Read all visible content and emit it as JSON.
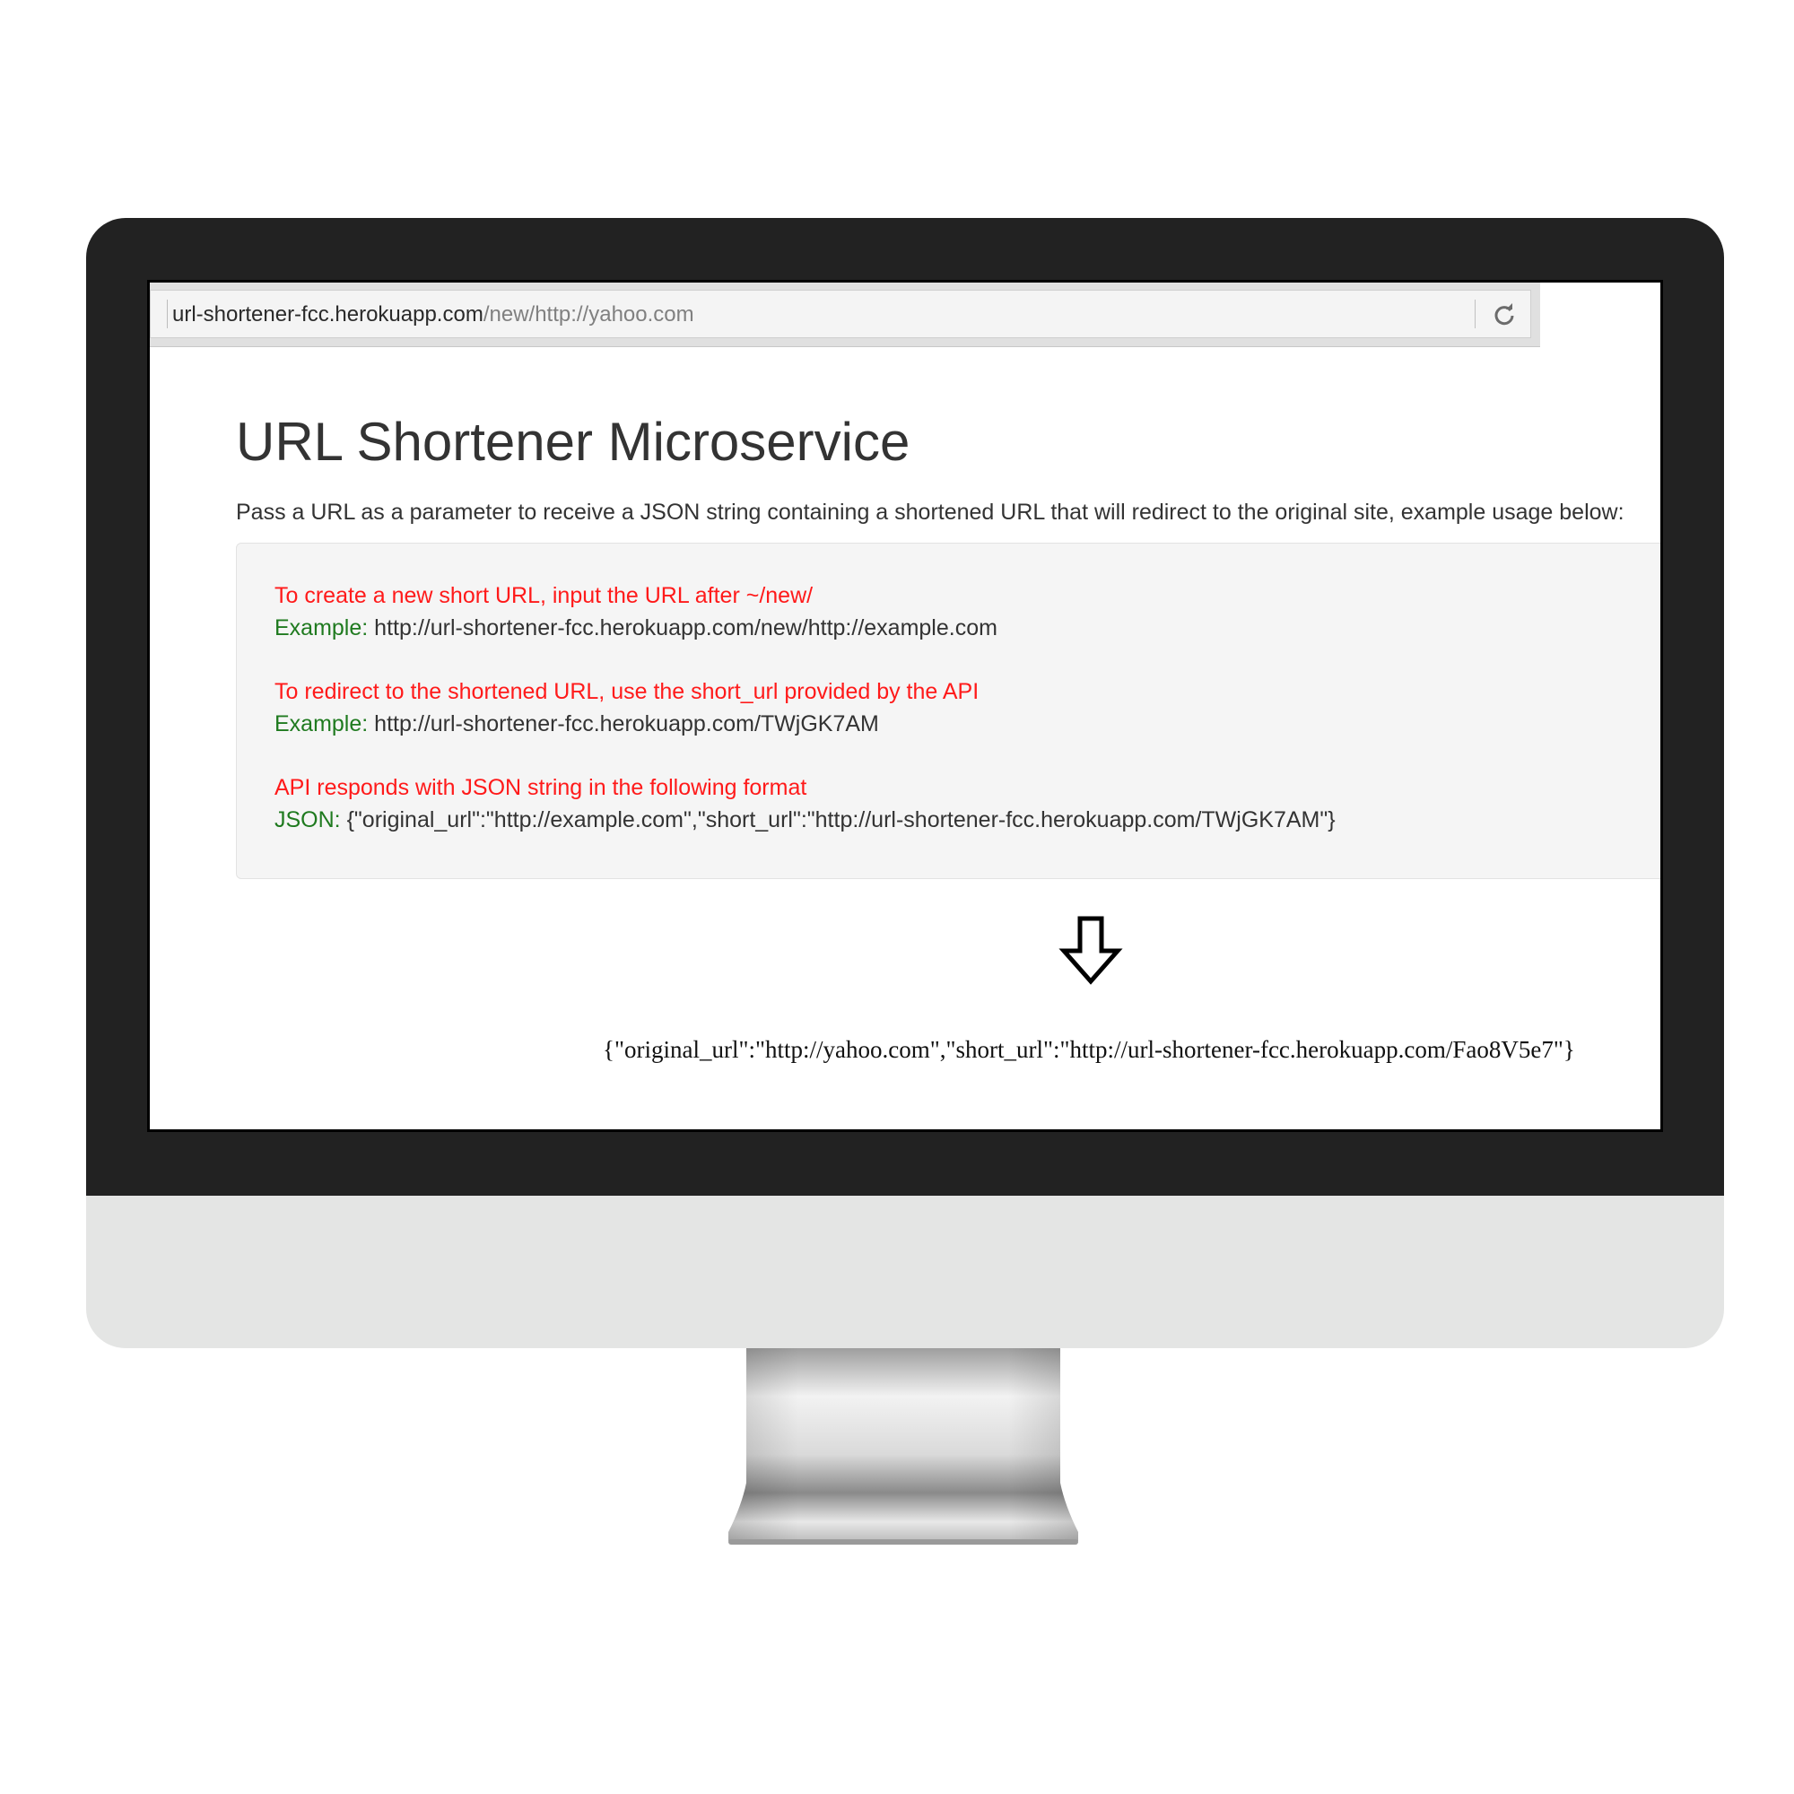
{
  "browser": {
    "address_host": "url-shortener-fcc.herokuapp.com",
    "address_path": "/new/http://yahoo.com",
    "reload_icon": "reload-icon"
  },
  "page": {
    "title": "URL Shortener Microservice",
    "description": "Pass a URL as a parameter to receive a JSON string containing a shortened URL that will redirect to the original site, example usage below:"
  },
  "instructions": [
    {
      "heading": "To create a new short URL, input the URL after ~/new/",
      "label": "Example:",
      "value": "http://url-shortener-fcc.herokuapp.com/new/http://example.com"
    },
    {
      "heading": "To redirect to the shortened URL, use the short_url provided by the API",
      "label": "Example:",
      "value": "http://url-shortener-fcc.herokuapp.com/TWjGK7AM"
    },
    {
      "heading": "API responds with JSON string in the following format",
      "label": "JSON:",
      "value": "{\"original_url\":\"http://example.com\",\"short_url\":\"http://url-shortener-fcc.herokuapp.com/TWjGK7AM\"}"
    }
  ],
  "arrow_icon": "arrow-down-icon",
  "response": "{\"original_url\":\"http://yahoo.com\",\"short_url\":\"http://url-shortener-fcc.herokuapp.com/Fao8V5e7\"}",
  "colors": {
    "bezel": "#222222",
    "chin": "#e4e5e4",
    "heading_red": "#ff1a1a",
    "label_green": "#1f7a1f",
    "text_dark": "#333333"
  }
}
